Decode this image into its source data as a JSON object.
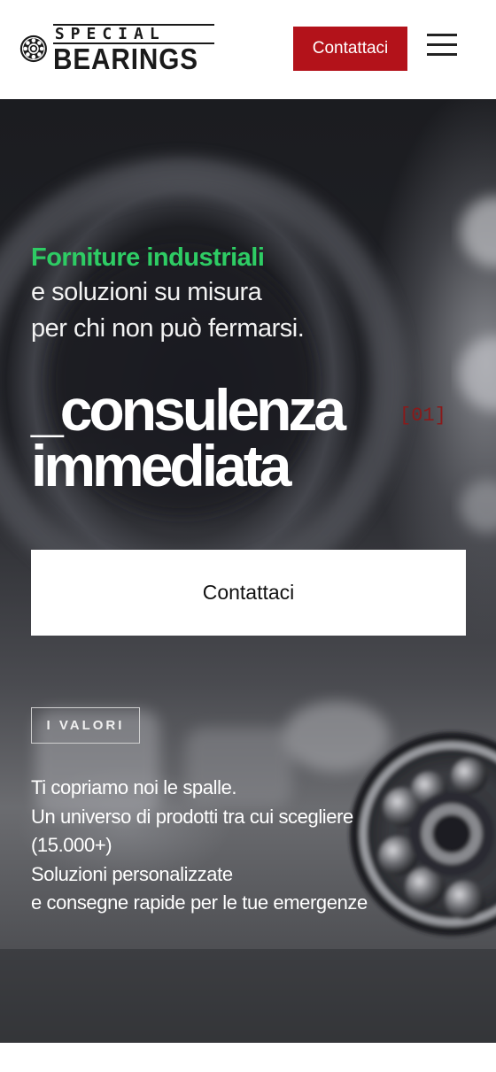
{
  "header": {
    "logo": {
      "line1": "SPECIAL",
      "line2": "BEARINGS"
    },
    "cta_label": "Contattaci",
    "menu_icon": "hamburger-menu-icon"
  },
  "hero": {
    "tagline_highlight": "Forniture industriali",
    "tagline_lines": [
      "e soluzioni su misura",
      "per chi non può fermarsi."
    ],
    "title_lines": [
      "_consulenza",
      "immediata"
    ],
    "index_tag": "[01]",
    "cta_label": "Contattaci",
    "values_badge": "I VALORI",
    "values_lines": [
      "Ti copriamo noi le spalle.",
      "Un universo di prodotti tra cui scegliere",
      "(15.000+)",
      "Soluzioni personalizzate",
      "e consegne rapide per le tue emergenze"
    ]
  },
  "colors": {
    "brand_red": "#b3121a",
    "accent_green": "#2ecc64",
    "index_red": "#8a1a1a",
    "text_dark": "#1a1a1a",
    "text_light": "#ffffff"
  }
}
